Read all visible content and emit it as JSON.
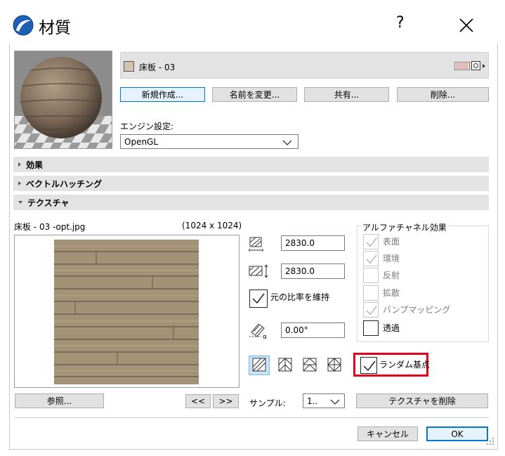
{
  "window": {
    "title": "材質",
    "help_label": "?",
    "close_label": "✕"
  },
  "material": {
    "name": "床板 - 03",
    "swatch_color": "#d2c3ae"
  },
  "actions": {
    "new_label": "新規作成...",
    "rename_label": "名前を変更...",
    "share_label": "共有...",
    "delete_label": "削除..."
  },
  "engine": {
    "label": "エンジン設定:",
    "value": "OpenGL"
  },
  "sections": {
    "effects": "効果",
    "vector_hatching": "ベクトルハッチング",
    "texture": "テクスチャ"
  },
  "texture": {
    "filename": "床板 - 03 -opt.jpg",
    "dimensions": "(1024 x 1024)",
    "width_value": "2830.0",
    "height_value": "2830.0",
    "keep_ratio_label": "元の比率を維持",
    "angle_value": "0.00°",
    "browse_label": "参照...",
    "prev_label": "<<",
    "next_label": ">>",
    "sample_label": "サンプル:",
    "sample_value": "1..",
    "remove_label": "テクスチャを削除",
    "random_origin_label": "ランダム基点"
  },
  "alpha": {
    "title": "アルファチャネル効果",
    "items": [
      {
        "label": "表面",
        "checked": true,
        "enabled": false
      },
      {
        "label": "環境",
        "checked": true,
        "enabled": false
      },
      {
        "label": "反射",
        "checked": false,
        "enabled": false
      },
      {
        "label": "拡散",
        "checked": false,
        "enabled": false
      },
      {
        "label": "バンプマッピング",
        "checked": true,
        "enabled": false
      },
      {
        "label": "透過",
        "checked": false,
        "enabled": true
      }
    ]
  },
  "footer": {
    "cancel_label": "キャンセル",
    "ok_label": "OK"
  },
  "colors": {
    "highlight_red": "#e0001b",
    "focus_blue": "#0078d7"
  }
}
